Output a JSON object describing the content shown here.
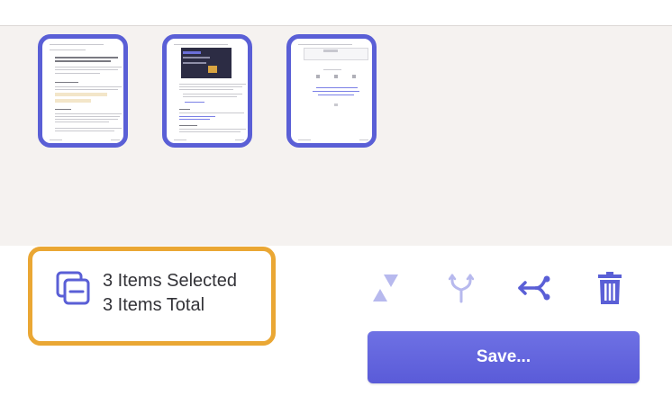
{
  "summary": {
    "selected_text": "3 Items Selected",
    "total_text": "3 Items Total",
    "icon": "select-all-icon"
  },
  "pages": [
    {
      "name": "page-thumbnail-1"
    },
    {
      "name": "page-thumbnail-2"
    },
    {
      "name": "page-thumbnail-3"
    }
  ],
  "toolbar": {
    "rotate_icon": "rotate-icon",
    "merge_icon": "merge-icon",
    "split_icon": "split-icon",
    "delete_icon": "trash-icon",
    "save_label": "Save..."
  },
  "colors": {
    "accent": "#5a5fd6",
    "summary_border": "#eaa734",
    "disabled_icon": "#b7b9ee",
    "canvas_bg": "#f5f2f0"
  }
}
